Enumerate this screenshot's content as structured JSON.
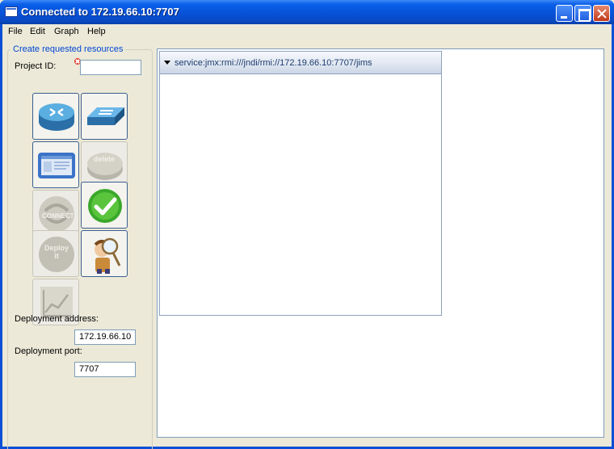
{
  "window": {
    "title": "Connected to 172.19.66.10:7707"
  },
  "menubar": {
    "items": [
      "File",
      "Edit",
      "Graph",
      "Help"
    ]
  },
  "panel": {
    "group_title": "Create requested resources",
    "project_id_label": "Project ID:",
    "project_id_value": "",
    "deployment_address_label": "Deployment address:",
    "deployment_address_value": "172.19.66.10",
    "deployment_port_label": "Deployment port:",
    "deployment_port_value": "7707",
    "tools": [
      {
        "icon": "router-icon",
        "enabled": true
      },
      {
        "icon": "switch-icon",
        "enabled": true
      },
      {
        "icon": "workstation-icon",
        "enabled": true
      },
      {
        "icon": "delete-icon",
        "label": "delete",
        "enabled": false
      },
      {
        "icon": "connect-icon",
        "label": "CONNECT",
        "enabled": false
      },
      {
        "icon": "check-icon",
        "enabled": true
      },
      {
        "icon": "deploy-icon",
        "label": "Deploy it",
        "enabled": false
      },
      {
        "icon": "inspector-icon",
        "enabled": true
      },
      {
        "icon": "graph-icon",
        "enabled": false
      }
    ]
  },
  "canvas": {
    "frame_title": "service:jmx:rmi:///jndi/rmi://172.19.66.10:7707/jims"
  },
  "colors": {
    "title_bar": "#0a5fe8",
    "group_title": "#0046d5",
    "frame_header": "#dfe6f1"
  }
}
